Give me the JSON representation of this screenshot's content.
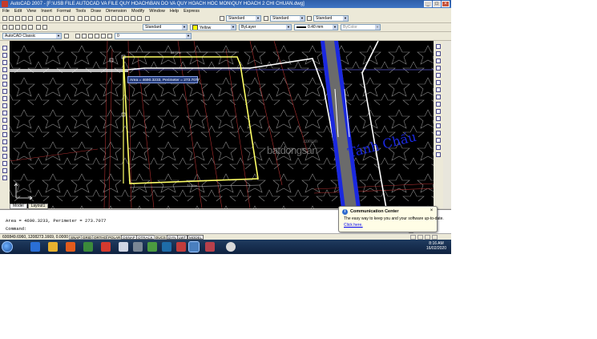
{
  "window": {
    "title": "AutoCAD 2007 - [F:\\USB FILE AUTOCAD VA FILE QUY HOACH\\BAN DO VA QUY HOACH HOC MON\\QUY HOACH 2 CHI CHUAN.dwg]",
    "buttons": [
      "_",
      "□",
      "×"
    ]
  },
  "menu": [
    "File",
    "Edit",
    "View",
    "Insert",
    "Format",
    "Tools",
    "Draw",
    "Dimension",
    "Modify",
    "Window",
    "Help",
    "Express"
  ],
  "toolbar1": {
    "text_style": "Standard",
    "dim_style": "Standard",
    "table_style": "Standard"
  },
  "toolbar2": {
    "layer": "Standard",
    "color": "Yellow",
    "linetype": "ByLayer",
    "lineweight": "0.40 mm",
    "plotstyle": "ByColor"
  },
  "toolbar3": {
    "workspace": "AutoCAD Classic",
    "layer_current": "0"
  },
  "drawing": {
    "tooltip": "Area = 4690.3233, Perimeter = 273.7077",
    "dim_top": "88.77m",
    "dim_bottom": "72.50m",
    "watermark_main": "batdongsan",
    "watermark_sub": ".com.vn",
    "street_label": "Tánh Chấu"
  },
  "tabs": [
    "Model",
    "Layout1"
  ],
  "command": {
    "line1": "Area = 4690.3233, Perimeter = 273.7077",
    "line2": "Command:"
  },
  "status": {
    "coords": "600849.6960, 1208273.1669, 0.0000",
    "buttons": [
      "SNAP",
      "GRID",
      "ORTHO",
      "POLAR",
      "OSNAP",
      "OTRACK",
      "DUCS",
      "DYN",
      "LWT",
      "MODEL"
    ],
    "on": [
      "OSNAP",
      "OTRACK",
      "DYN",
      "LWT",
      "MODEL"
    ]
  },
  "comm_center": {
    "title": "Communication Center",
    "body": "The easy way to keep you and your software up-to-date.",
    "link": "Click here."
  },
  "clock": {
    "time": "8:16 AM",
    "date": "16/02/2020"
  },
  "colors": {
    "titlebar": "#2d5ea8",
    "viewport": "#000000",
    "boundary": "#ffff66",
    "road": "#1a28e0"
  }
}
